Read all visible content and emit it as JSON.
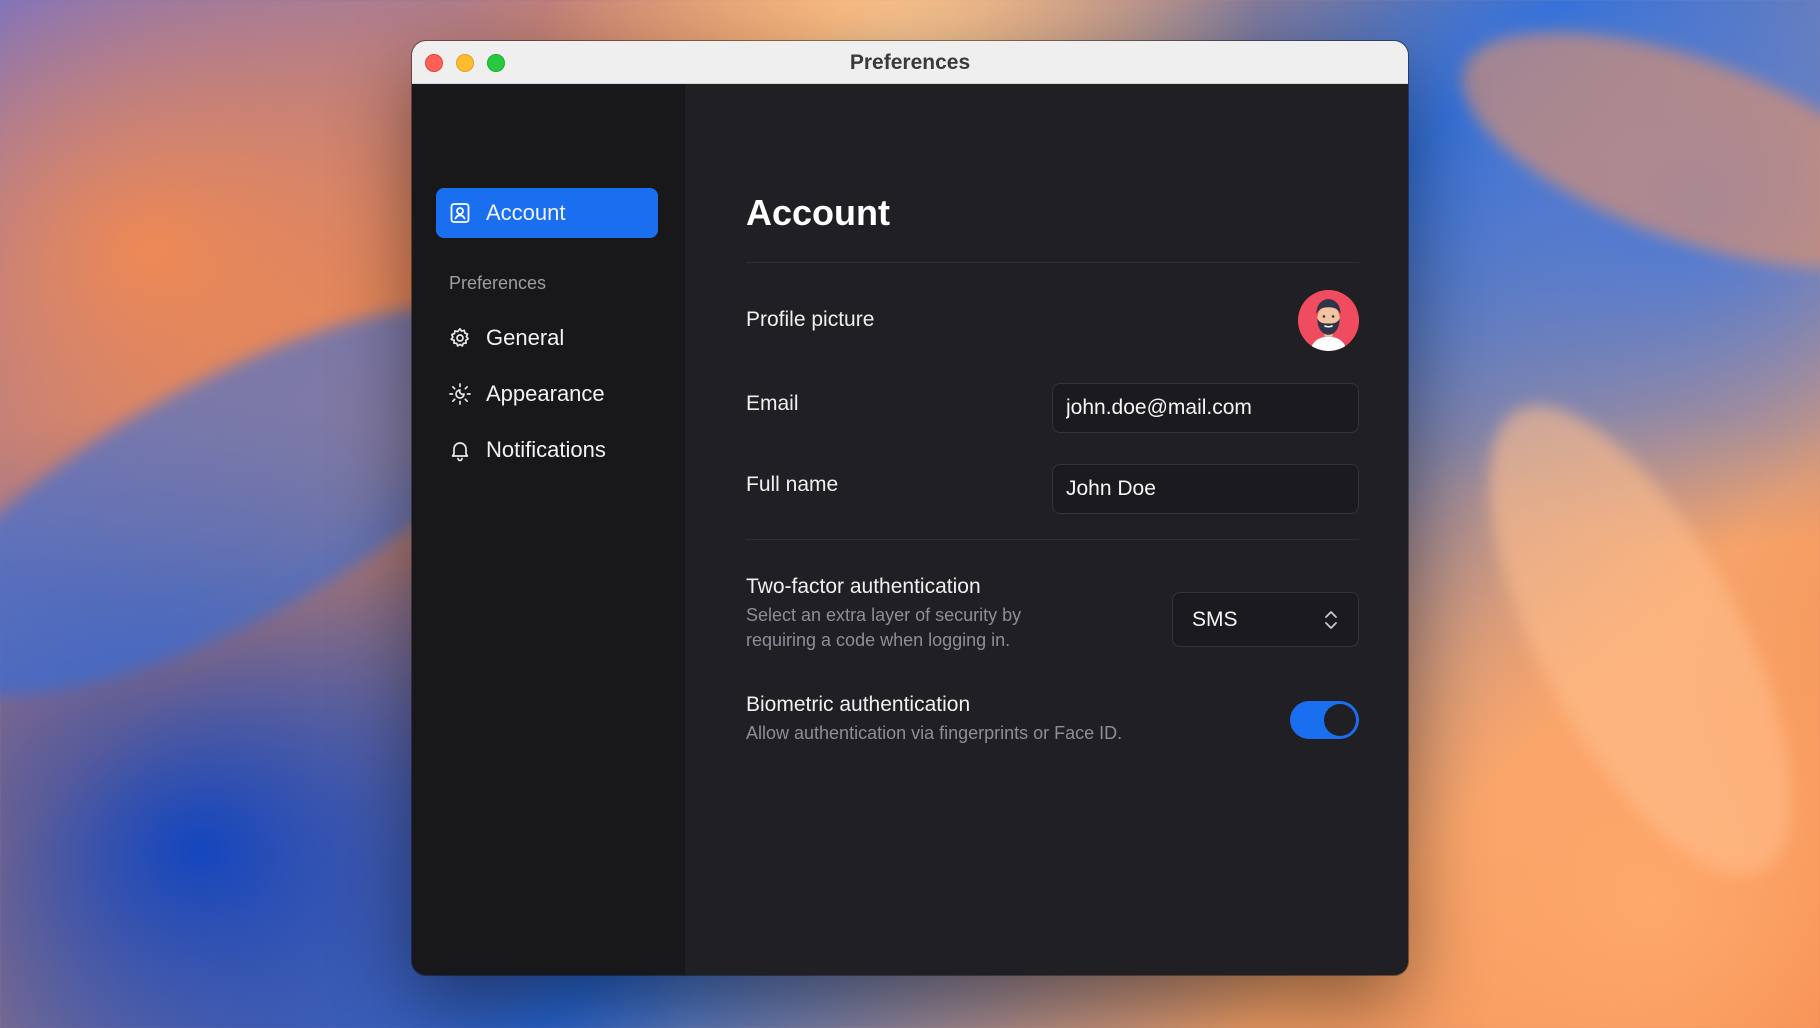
{
  "window": {
    "title": "Preferences"
  },
  "sidebar": {
    "active_item": {
      "label": "Account",
      "icon": "account-icon"
    },
    "section_label": "Preferences",
    "items": [
      {
        "label": "General",
        "icon": "gear-icon"
      },
      {
        "label": "Appearance",
        "icon": "appearance-icon"
      },
      {
        "label": "Notifications",
        "icon": "bell-icon"
      }
    ]
  },
  "main": {
    "title": "Account",
    "profile_picture": {
      "label": "Profile picture"
    },
    "email": {
      "label": "Email",
      "value": "john.doe@mail.com"
    },
    "full_name": {
      "label": "Full name",
      "value": "John Doe"
    },
    "two_factor": {
      "label": "Two-factor authentication",
      "description_line1": "Select an extra layer of security by",
      "description_line2": "requiring a code when logging in.",
      "selected": "SMS"
    },
    "biometric": {
      "label": "Biometric authentication",
      "description": "Allow authentication via fingerprints or Face ID.",
      "enabled": true
    }
  },
  "colors": {
    "accent": "#1a6ff0",
    "sidebar_bg": "#18181b",
    "content_bg": "#1f1f24",
    "avatar_bg": "#f04b5e"
  }
}
